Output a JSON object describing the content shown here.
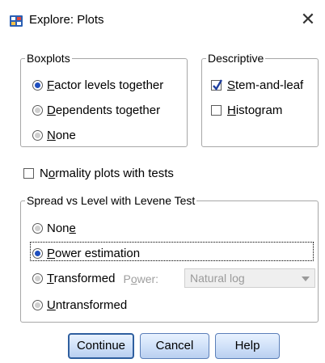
{
  "window": {
    "title": "Explore: Plots",
    "close_glyph": "✕",
    "icon": "spss-app-icon"
  },
  "boxplots": {
    "legend": "Boxplots",
    "options": [
      {
        "label": "Factor levels together",
        "mnemonic": "F",
        "rest": "actor levels together",
        "selected": true
      },
      {
        "label": "Dependents together",
        "mnemonic": "D",
        "rest": "ependents together",
        "selected": false
      },
      {
        "label": "None",
        "mnemonic": "N",
        "rest": "one",
        "selected": false
      }
    ]
  },
  "descriptive": {
    "legend": "Descriptive",
    "options": [
      {
        "label": "Stem-and-leaf",
        "mnemonic": "S",
        "rest": "tem-and-leaf",
        "checked": true
      },
      {
        "label": "Histogram",
        "mnemonic": "H",
        "rest": "istogram",
        "checked": false
      }
    ]
  },
  "normality": {
    "label": "Normality plots with tests",
    "prefix": "N",
    "mnemonic": "o",
    "rest": "rmality plots with tests",
    "checked": false
  },
  "spread": {
    "legend": "Spread vs Level with Levene Test",
    "options": [
      {
        "label": "None",
        "before": "Non",
        "mnemonic": "e",
        "after": "",
        "selected": false
      },
      {
        "label": "Power estimation",
        "before": "",
        "mnemonic": "P",
        "after": "ower estimation",
        "selected": true
      },
      {
        "label": "Transformed",
        "before": "",
        "mnemonic": "T",
        "after": "ransformed",
        "selected": false
      },
      {
        "label": "Untransformed",
        "before": "",
        "mnemonic": "U",
        "after": "ntransformed",
        "selected": false
      }
    ],
    "power_label_before": "P",
    "power_label_mnemonic": "o",
    "power_label_after": "wer:",
    "power_value": "Natural log"
  },
  "buttons": {
    "continue": "Continue",
    "cancel": "Cancel",
    "help": "Help"
  },
  "colors": {
    "accent": "#1f4fbf",
    "button_border": "#5b7fb9",
    "group_border": "#a7a7a7"
  }
}
